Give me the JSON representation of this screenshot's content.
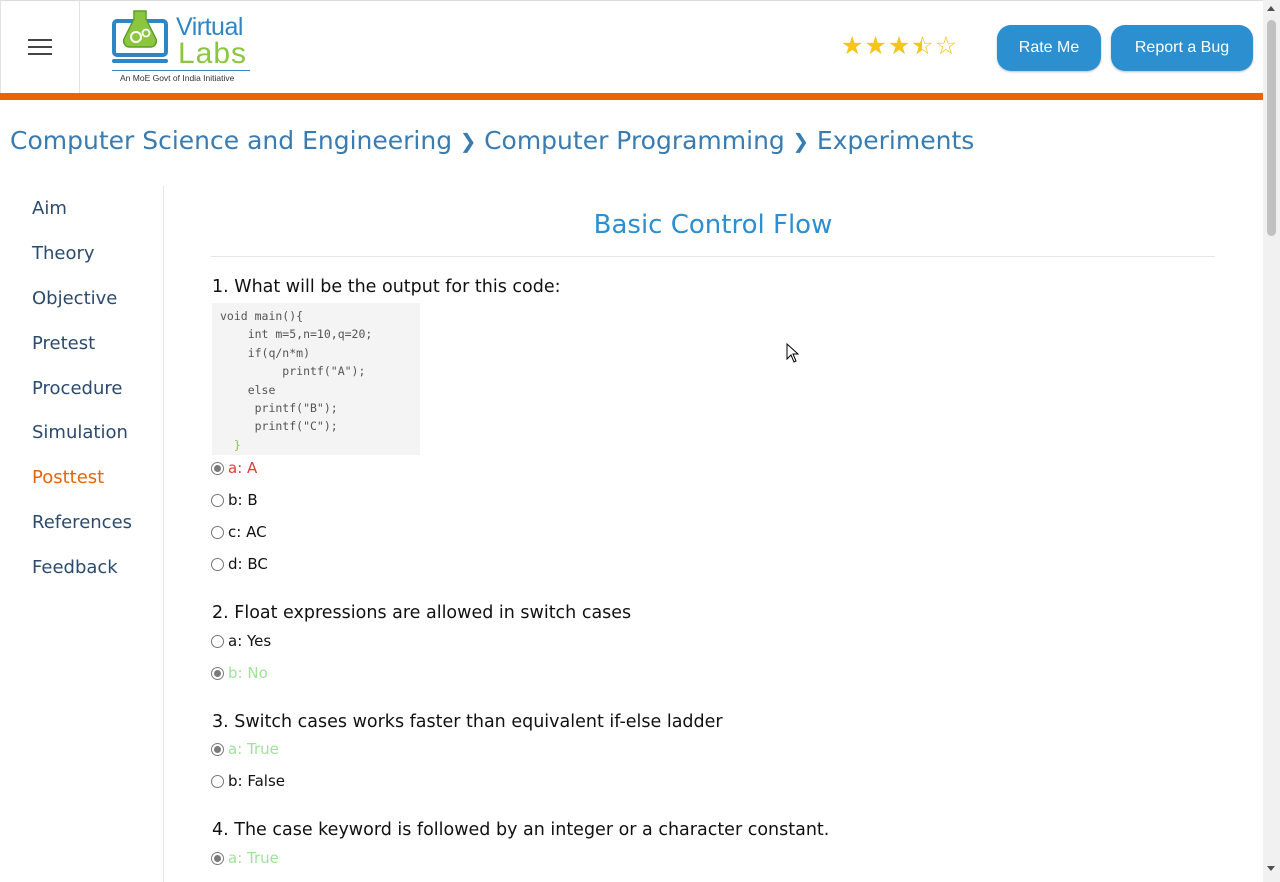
{
  "header": {
    "menu_icon": "hamburger-icon",
    "logo": {
      "word1": "Virtual",
      "word2": "Labs",
      "tagline": "An MoE Govt of India Initiative"
    },
    "rating": {
      "value": 3.5,
      "max": 5
    },
    "rate_label": "Rate Me",
    "bug_label": "Report a Bug",
    "accent": "#e8630a",
    "button_color": "#2b8fd0"
  },
  "breadcrumb": {
    "items": [
      "Computer Science and Engineering",
      "Computer Programming",
      "Experiments"
    ],
    "separator_icon": "chevron-right-icon"
  },
  "sidebar": {
    "items": [
      {
        "label": "Aim"
      },
      {
        "label": "Theory"
      },
      {
        "label": "Objective"
      },
      {
        "label": "Pretest"
      },
      {
        "label": "Procedure"
      },
      {
        "label": "Simulation"
      },
      {
        "label": "Posttest",
        "active": true
      },
      {
        "label": "References"
      },
      {
        "label": "Feedback"
      }
    ]
  },
  "main": {
    "title": "Basic Control Flow",
    "questions": [
      {
        "text": "1. What will be the output for this code:",
        "code": [
          "void main(){",
          "    int m=5,n=10,q=20;",
          "    if(q/n*m)",
          "         printf(\"A\");",
          "    else",
          "     printf(\"B\");",
          "     printf(\"C\");",
          "  }"
        ],
        "options": [
          {
            "label": "a: A",
            "selected": true,
            "state": "wrong"
          },
          {
            "label": "b: B",
            "selected": false
          },
          {
            "label": "c: AC",
            "selected": false
          },
          {
            "label": "d: BC",
            "selected": false
          }
        ]
      },
      {
        "text": "2. Float expressions are allowed in switch cases",
        "options": [
          {
            "label": "a: Yes",
            "selected": false
          },
          {
            "label": "b: No",
            "selected": true,
            "state": "right"
          }
        ]
      },
      {
        "text": "3. Switch cases works faster than equivalent if-else ladder",
        "options": [
          {
            "label": "a: True",
            "selected": true,
            "state": "right"
          },
          {
            "label": "b: False",
            "selected": false
          }
        ]
      },
      {
        "text": "4. The case keyword is followed by an integer or a character constant.",
        "options": [
          {
            "label": "a: True",
            "selected": true,
            "state": "right"
          }
        ]
      }
    ],
    "colors": {
      "wrong": "#e53935",
      "right": "#9ee39a",
      "active_nav": "#e8630a"
    }
  }
}
